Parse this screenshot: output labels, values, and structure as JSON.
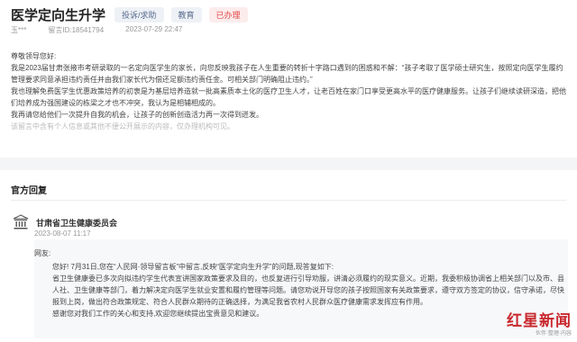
{
  "header": {
    "title": "医学定向生升学",
    "tags": [
      "投诉/求助",
      "教育",
      "已办理"
    ]
  },
  "meta": {
    "author": "玉***",
    "message_id": "留言ID:18541794",
    "timestamp": "2023-07-29 22:47"
  },
  "message": {
    "salutation": "尊敬领导您好:",
    "paragraphs": [
      "我是2023届甘肃张掖市考研录取的一名定向医学生的家长，向您反映我孩子在人生重要的转折十字路口遇到的困惑和不解：“孩子考取了医学硕士研究生，按照定向医学生履约管理要求同意承担违约责任并由我们家长代为偿还足额违约责任金。可相关部门明确阻止违约。”",
      "我也理解免费医学生优惠政策培养的初衷是为基层培养造就一批高素质本土化的医疗卫生人才，让老百姓在家门口享受更高水平的医疗健康服务。让孩子们继续读研深造，把他们培养成为强国建设的栋梁之才也不冲突，我认为是相辅相成的。",
      "我再请您给他们一次提升自我的机会，让孩子的创新创造活力再一次得到迸发。"
    ],
    "notice": "该留言中含有个人信息或其他不便公开展示的内容，仅办理机构可见。"
  },
  "reply": {
    "section_title": "官方回复",
    "org_name": "甘肃省卫生健康委员会",
    "date": "2023-08-07 11:17",
    "greeting": "网友:",
    "paragraphs": [
      "您好! 7月31日,您在“人民网·领导留言板”中留言,反映“医学定向生升学”的问题,现答复如下:",
      "省卫生健康委已多次向拟违约学生代表宣讲国家政策要求及目的，也反复进行引导劝服，讲清必须履约的现实意义。近期，我委积极协调省上相关部门以及市、县人社、卫生健康等部门，着力解决定向医学生就业安置和履约管理等问题。请您劝说开导您的孩子按照国家有关政策要求，遵守双方签定的协议，信守承诺，尽快报到上岗，做出符合政策规定、符合人民群众期待的正确选择，为满足我省农村人民群众医疗健康需求发挥应有作用。",
      "感谢您对我们工作的关心和支持,欢迎您继续提出宝贵意见和建议。"
    ]
  },
  "watermark": {
    "main": "红星新闻",
    "sub": "伙伴·整理·内容"
  }
}
